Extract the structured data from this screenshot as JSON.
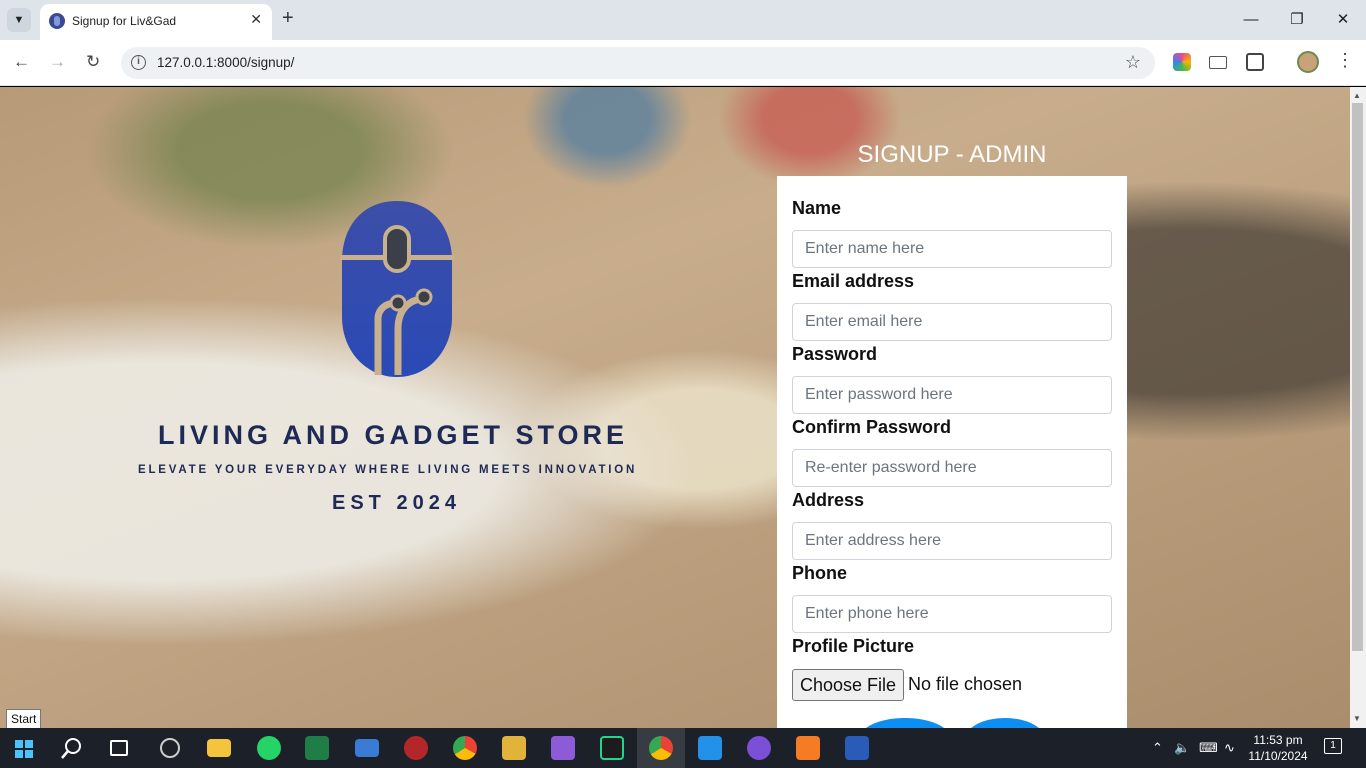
{
  "browser": {
    "tab_title": "Signup for Liv&Gad",
    "url": "127.0.0.1:8000/signup/",
    "new_tab_label": "+",
    "tab_close_label": "✕"
  },
  "brand": {
    "title": "LIVING AND GADGET STORE",
    "tagline": "ELEVATE YOUR EVERYDAY WHERE LIVING MEETS INNOVATION",
    "est": "EST 2024"
  },
  "signup": {
    "heading": "SIGNUP - ADMIN",
    "fields": [
      {
        "label": "Name",
        "placeholder": "Enter name here"
      },
      {
        "label": "Email address",
        "placeholder": "Enter email here"
      },
      {
        "label": "Password",
        "placeholder": "Enter password here"
      },
      {
        "label": "Confirm Password",
        "placeholder": "Re-enter password here"
      },
      {
        "label": "Address",
        "placeholder": "Enter address here"
      },
      {
        "label": "Phone",
        "placeholder": "Enter phone here"
      }
    ],
    "profile_label": "Profile Picture",
    "file_button": "Choose File",
    "file_status": "No file chosen"
  },
  "tooltip": "Start",
  "taskbar": {
    "time": "11:53 pm",
    "date": "11/10/2024",
    "notification_count": "1"
  },
  "colors": {
    "brand_navy": "#1e2a55",
    "button_blue": "#0d8ef0"
  }
}
